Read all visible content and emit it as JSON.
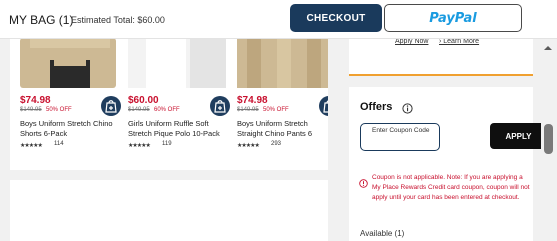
{
  "header": {
    "bag_title": "MY BAG (1)",
    "estimated_total": "Estimated Total: $60.00",
    "checkout_label": "CHECKOUT",
    "paypal_label": "PayPal"
  },
  "credit_links": {
    "apply_now": "Apply Now",
    "learn_more": "› Learn More"
  },
  "products": [
    {
      "price": "$74.98",
      "original_price": "$149.95",
      "discount": "50% OFF",
      "name": "Boys Uniform Stretch Chino Shorts 6-Pack",
      "stars": "★★★★★",
      "reviews": "114",
      "thumb_color": "#c8b48c"
    },
    {
      "price": "$60.00",
      "original_price": "$149.95",
      "discount": "60% OFF",
      "name": "Girls Uniform Ruffle Soft Stretch Pique Polo 10-Pack",
      "stars": "★★★★★",
      "reviews": "119",
      "thumb_color": "#e6e6e6"
    },
    {
      "price": "$74.98",
      "original_price": "$149.95",
      "discount": "50% OFF",
      "name": "Boys Uniform Stretch Straight Chino Pants 6",
      "stars": "★★★★★",
      "reviews": "293",
      "thumb_color": "#c8b48c"
    }
  ],
  "offers": {
    "title": "Offers",
    "coupon_placeholder": "Enter Coupon Code",
    "apply_label": "APPLY",
    "error_message": "Coupon is not applicable. Note: If you are applying a My Place Rewards Credit card coupon, coupon will not apply until your card has been entered at checkout.",
    "available_label": "Available (1)"
  },
  "colors": {
    "brand_navy": "#1a3a5c",
    "sale_red": "#c8102e",
    "paypal_blue": "#1a9be0",
    "accent_orange": "#f0a030"
  }
}
